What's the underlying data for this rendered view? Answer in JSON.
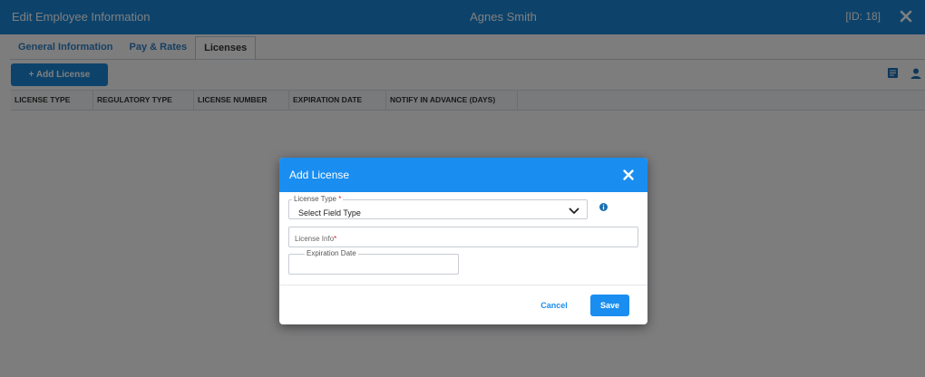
{
  "window": {
    "title": "Edit Employee Information",
    "employee_name": "Agnes Smith",
    "id_label": "[ID: 18]"
  },
  "tabs": [
    {
      "label": "General Information",
      "active": false
    },
    {
      "label": "Pay & Rates",
      "active": false
    },
    {
      "label": "Licenses",
      "active": true
    }
  ],
  "toolbar": {
    "add_label": "+ Add License",
    "icons": [
      "list-export-icon",
      "person-icon"
    ]
  },
  "grid": {
    "columns": [
      "LICENSE TYPE",
      "REGULATORY TYPE",
      "LICENSE NUMBER",
      "EXPIRATION DATE",
      "NOTIFY IN ADVANCE (DAYS)"
    ]
  },
  "modal": {
    "title": "Add License",
    "license_type": {
      "label": "License Type",
      "required_mark": "*",
      "value": "Select Field Type"
    },
    "license_info": {
      "label": "License Info",
      "required_mark": "*"
    },
    "expiration_date": {
      "label": "Expiration Date"
    },
    "cancel_label": "Cancel",
    "save_label": "Save"
  },
  "colors": {
    "header_blue": "#1a86d6",
    "modal_blue": "#1a8ef0",
    "required_red": "#e0202a"
  }
}
